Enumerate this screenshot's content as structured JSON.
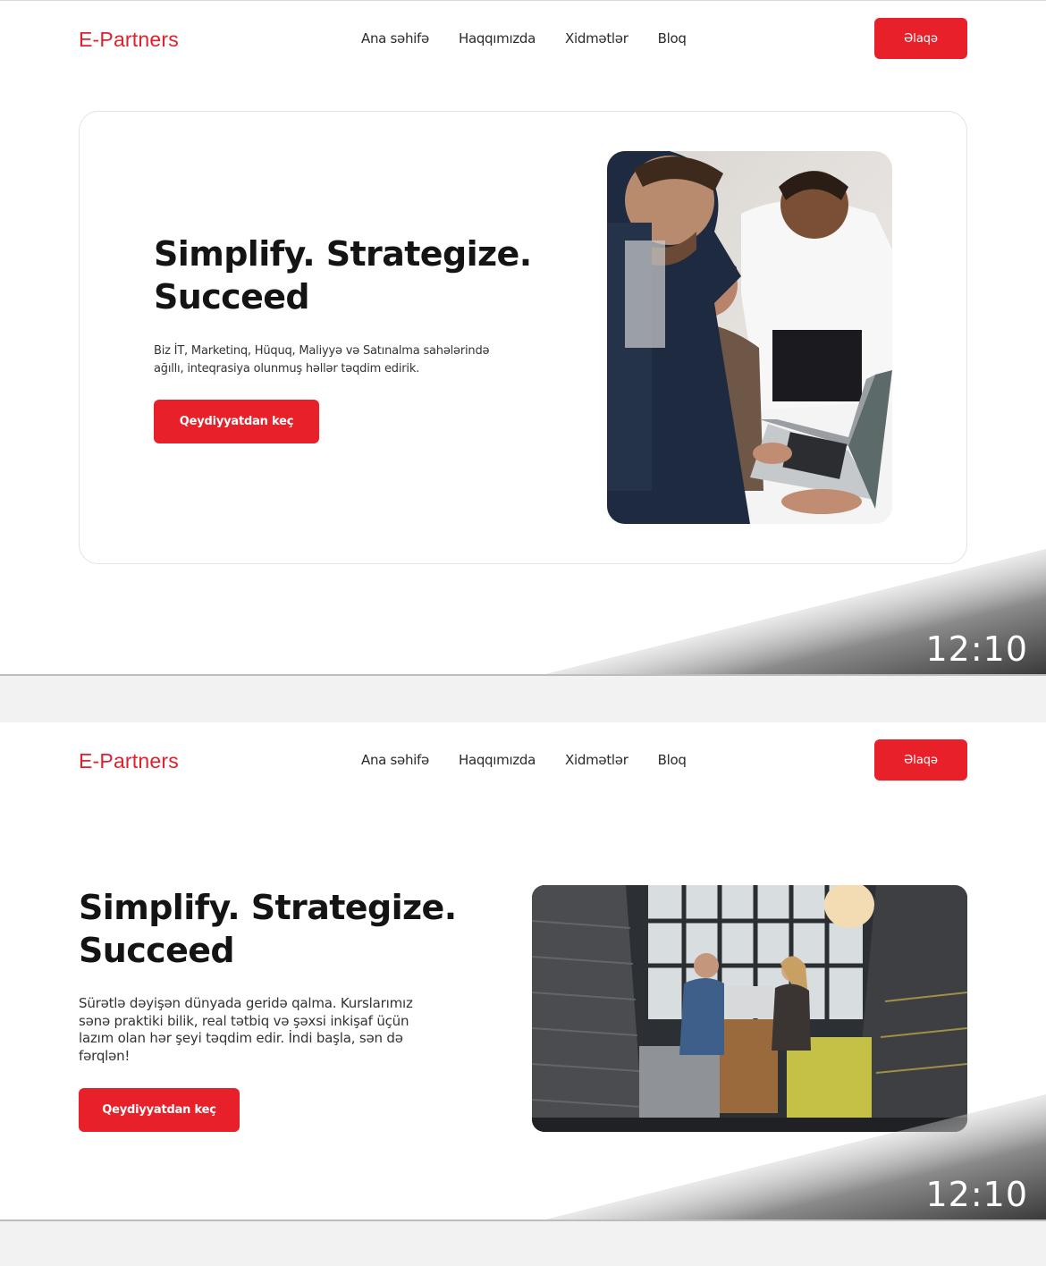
{
  "frames": [
    {
      "header": {
        "logo": "E-Partners",
        "nav": [
          "Ana səhifə",
          "Haqqımızda",
          "Xidmətlər",
          "Bloq"
        ],
        "contact_button": "Əlaqə"
      },
      "hero": {
        "title_line1": "Simplify. Strategize.",
        "title_line2": "Succeed",
        "description_line1": "Biz İT, Marketinq, Hüquq, Maliyyə və Satınalma sahələrində",
        "description_line2": "ağıllı, inteqrasiya olunmuş həllər təqdim edirik.",
        "cta": "Qeydiyyatdan keç"
      },
      "time": "12:10"
    },
    {
      "header": {
        "logo": "E-Partners",
        "nav": [
          "Ana səhifə",
          "Haqqımızda",
          "Xidmətlər",
          "Bloq"
        ],
        "contact_button": "Əlaqə"
      },
      "hero": {
        "title_line1": "Simplify. Strategize.",
        "title_line2": "Succeed",
        "description_lines": [
          "Sürətlə dəyişən dünyada geridə qalma. Kurslarımız",
          "sənə praktiki bilik, real tətbiq və şəxsi inkişaf üçün",
          "lazım olan hər şeyi təqdim edir. İndi başla, sən də",
          "fərqlən!"
        ],
        "cta": "Qeydiyyatdan keç"
      },
      "time": "12:10"
    }
  ],
  "colors": {
    "accent": "#e8202a",
    "logo": "#e41e2b",
    "text": "#141414"
  },
  "icons": {
    "hero_image_1": "team-meeting-photo",
    "hero_image_2": "office-meeting-photo"
  }
}
